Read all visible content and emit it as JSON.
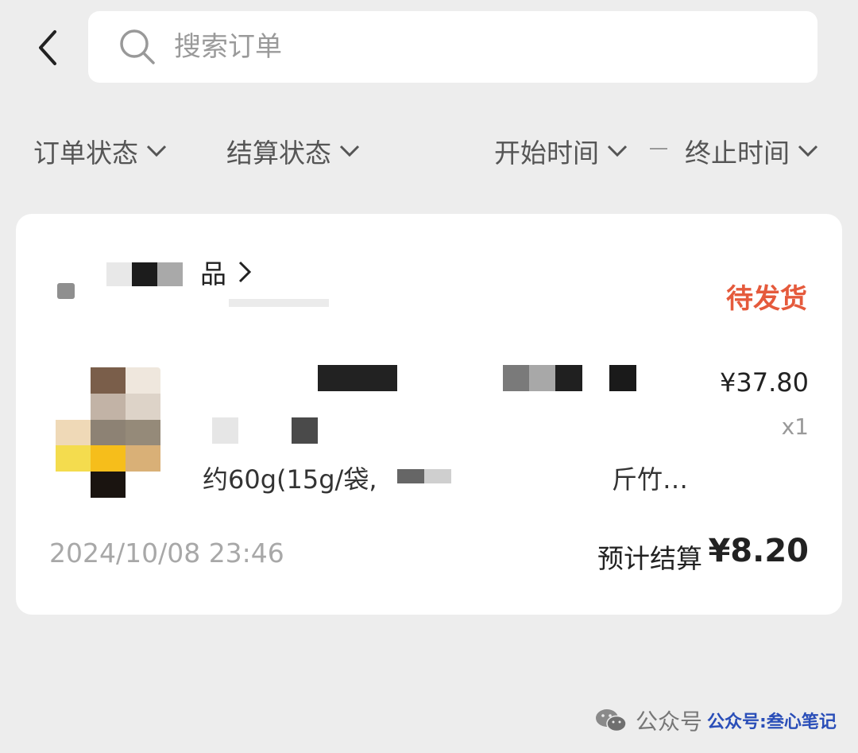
{
  "header": {
    "search_placeholder": "搜索订单"
  },
  "filters": {
    "order_status": "订单状态",
    "settlement_status": "结算状态",
    "start_time": "开始时间",
    "end_time": "终止时间"
  },
  "order": {
    "shop_name_visible": "品",
    "status": "待发货",
    "product_desc_visible": "约60g(15g/袋,",
    "product_desc_tail": "斤竹…",
    "price": "¥37.80",
    "quantity": "x1",
    "timestamp": "2024/10/08 23:46",
    "settlement_label": "预计结算",
    "settlement_amount": "¥8.20"
  },
  "watermark": {
    "text": "公众号",
    "strong": "公众号:叁心笔记"
  },
  "colors": {
    "background": "#ededed",
    "status_accent": "#e55a3c"
  }
}
